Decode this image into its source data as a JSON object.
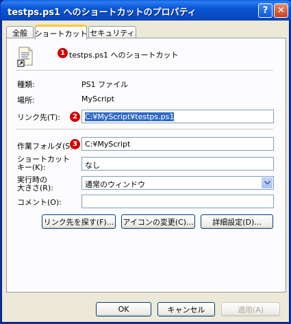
{
  "window": {
    "title": "testps.ps1 へのショートカットのプロパティ",
    "help_button": "?",
    "close_button": "✕"
  },
  "tabs": [
    {
      "label": "全般"
    },
    {
      "label": "ショートカット"
    },
    {
      "label": "セキュリティ"
    }
  ],
  "header": {
    "file_name": "testps.ps1 へのショートカット"
  },
  "markers": [
    "1",
    "2",
    "3"
  ],
  "fields": {
    "type_label": "種類:",
    "type_value": "PS1 ファイル",
    "location_label": "場所:",
    "location_value": "MyScript",
    "target_label": "リンク先(T):",
    "target_value": "C:¥MyScript¥testps.ps1",
    "workdir_label": "作業フォルダ(S):",
    "workdir_value": "C:¥MyScript",
    "shortcut_label_line1": "ショートカット",
    "shortcut_label_line2": "キー(K):",
    "shortcut_value": "なし",
    "run_label_line1": "実行時の",
    "run_label_line2": "大きさ(R):",
    "run_value": "通常のウィンドウ",
    "comment_label": "コメント(O):",
    "comment_value": ""
  },
  "buttons": {
    "find_target": "リンク先を探す(F)...",
    "change_icon": "アイコンの変更(C)...",
    "advanced": "詳細設定(D)...",
    "ok": "OK",
    "cancel": "キャンセル",
    "apply": "適用(A)"
  },
  "colors": {
    "title_bar": "#0a56d4",
    "marker": "#d40000",
    "selection": "#316ac5",
    "active_tab_accent": "#ffc83c"
  }
}
